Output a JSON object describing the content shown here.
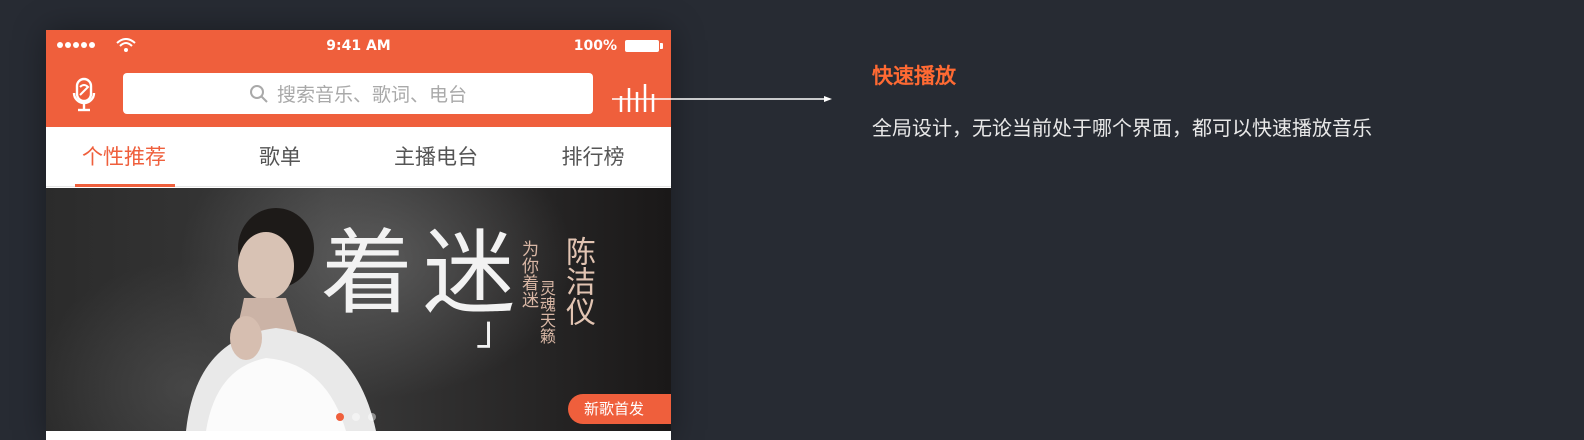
{
  "status_bar": {
    "time": "9:41 AM",
    "battery": "100%"
  },
  "header": {
    "search_placeholder": "搜索音乐、歌词、电台",
    "mic_icon": "mic-icon",
    "eq_icon": "equalizer-icon"
  },
  "tabs": [
    {
      "label": "个性推荐",
      "active": true
    },
    {
      "label": "歌单",
      "active": false
    },
    {
      "label": "主播电台",
      "active": false
    },
    {
      "label": "排行榜",
      "active": false
    }
  ],
  "banner": {
    "title_chars": "着迷",
    "subtitle": "为你着迷",
    "tagline": "灵魂天籁",
    "artist": "陈洁仪",
    "badge": "新歌首发",
    "page_count": 3,
    "active_page": 1
  },
  "annotation": {
    "title": "快速播放",
    "description": "全局设计，无论当前处于哪个界面，都可以快速播放音乐"
  },
  "colors": {
    "accent": "#ef5f3c",
    "background": "#272b33",
    "annotation_title": "#ff6a33"
  }
}
